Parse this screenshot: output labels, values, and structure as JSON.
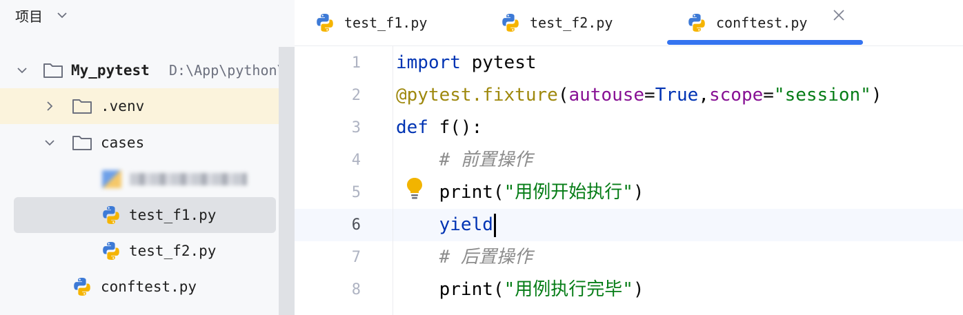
{
  "panel": {
    "title": "项目"
  },
  "tree": {
    "root": {
      "name": "My_pytest",
      "path": "D:\\App\\python\\"
    },
    "venv": "venv",
    "cases": "cases",
    "blurred_file": "",
    "test_f1": "test_f1.py",
    "test_f2": "test_f2.py",
    "conftest": "conftest.py"
  },
  "tabs": [
    {
      "label": "test_f1.py"
    },
    {
      "label": "test_f2.py"
    },
    {
      "label": "conftest.py",
      "active": true
    }
  ],
  "editor": {
    "line_numbers": [
      "1",
      "2",
      "3",
      "4",
      "5",
      "6",
      "7",
      "8"
    ],
    "current_line": "6",
    "lines": {
      "l1": {
        "kw": "import",
        "rest": " pytest"
      },
      "l2": {
        "dec": "@pytest.fixture",
        "p1": "(",
        "param1": "autouse",
        "eq1": "=",
        "val1": "True",
        "comma": ",",
        "param2": "scope",
        "eq2": "=",
        "str": "\"session\"",
        "p2": ")"
      },
      "l3": {
        "kw": "def",
        "rest": " f():"
      },
      "l4": {
        "indent": "    ",
        "cmt": "# 前置操作"
      },
      "l5": {
        "indent": "    ",
        "fn": "print",
        "p1": "(",
        "str": "\"用例开始执行\"",
        "p2": ")"
      },
      "l6": {
        "indent": "    ",
        "kw": "yield"
      },
      "l7": {
        "indent": "    ",
        "cmt": "# 后置操作"
      },
      "l8": {
        "indent": "    ",
        "fn": "print",
        "p1": "(",
        "str": "\"用例执行完毕\"",
        "p2": ")"
      }
    }
  },
  "colors": {
    "accent": "#3574f0",
    "keyword": "#0033b3",
    "string": "#067d17",
    "decorator": "#9e880d",
    "param": "#871094"
  },
  "icons": [
    "chevron-down-icon",
    "chevron-right-icon",
    "folder-icon",
    "python-file-icon",
    "close-icon",
    "lightbulb-icon"
  ]
}
